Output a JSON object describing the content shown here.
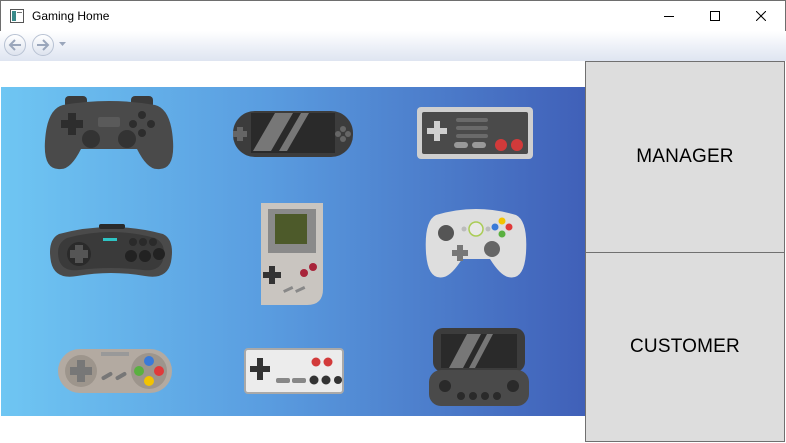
{
  "window": {
    "title": "Gaming Home"
  },
  "nav": {
    "back_icon": "back-arrow-icon",
    "forward_icon": "forward-arrow-icon",
    "dropdown_icon": "chevron-down-icon"
  },
  "controls": {
    "minimize_icon": "minimize-icon",
    "maximize_icon": "maximize-icon",
    "close_icon": "close-icon"
  },
  "sidebar": {
    "manager_label": "MANAGER",
    "customer_label": "CUSTOMER"
  },
  "gallery": {
    "background_gradient": [
      "#6fc6f3",
      "#4060b8"
    ],
    "items": [
      "playstation-controller-icon",
      "psp-handheld-icon",
      "nes-controller-icon",
      "sega-genesis-controller-icon",
      "gameboy-icon",
      "xbox-360-controller-icon",
      "snes-controller-icon",
      "famicom-controller-icon",
      "psp-go-handheld-icon"
    ]
  }
}
